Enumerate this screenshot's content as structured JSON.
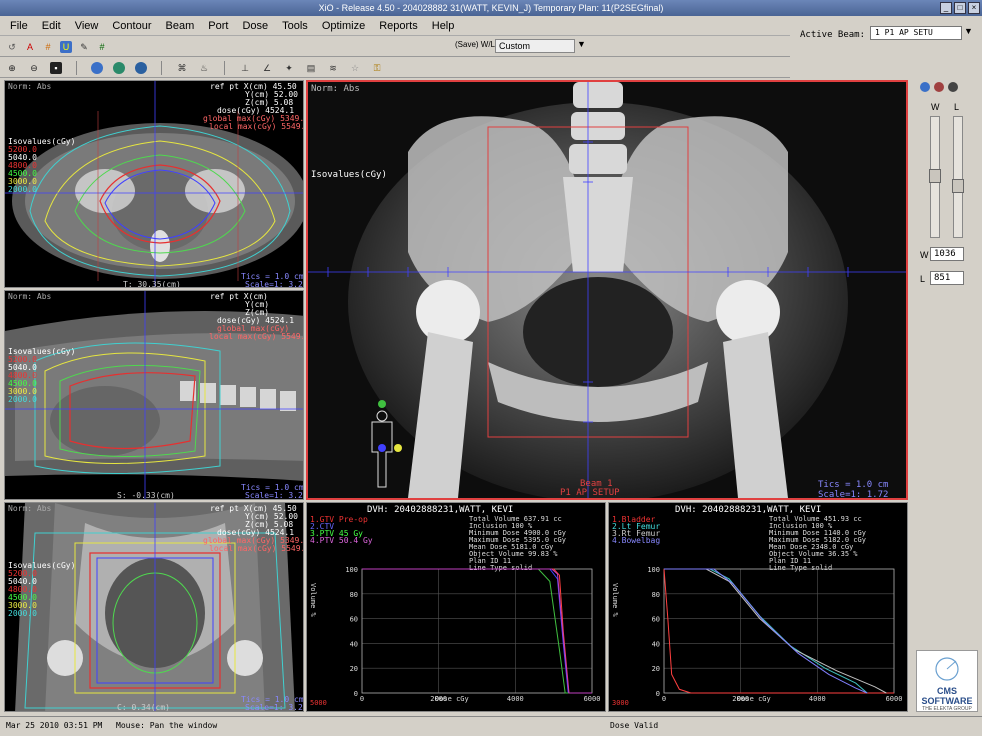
{
  "window": {
    "title": "XiO - Release 4.50 - 204028882 31(WATT, KEVIN_J) Temporary Plan: 11(P2SEGfinal)"
  },
  "menu": [
    "File",
    "Edit",
    "View",
    "Contour",
    "Beam",
    "Port",
    "Dose",
    "Tools",
    "Optimize",
    "Reports",
    "Help"
  ],
  "toolbar": {
    "save_wl_label": "(Save) W/L",
    "wl_preset": "Custom"
  },
  "active_beam": {
    "label": "Active Beam:",
    "value": "1 P1 AP SETU"
  },
  "window_level": {
    "w_label": "W",
    "l_label": "L",
    "w_value": "1036",
    "l_value": "851",
    "w_field_label": "W",
    "l_field_label": "L"
  },
  "axial_view": {
    "norm": "Norm: Abs",
    "ref_lines": [
      "ref pt  X(cm)  45.50",
      "Y(cm)  52.00",
      "Z(cm)   5.08",
      "dose(cGy)  4524.1",
      "global max(cGy)  5349.0",
      "local max(cGy)  5549.0"
    ],
    "isovalues_title": "Isovalues(cGy)",
    "isovalues": [
      "5200.0",
      "5040.0",
      "4800.0",
      "4500.0",
      "3000.0",
      "2000.0"
    ],
    "coord": "T:  30.35(cm)",
    "tics": "Tics = 1.0 cm",
    "scale": "Scale=1: 3.23"
  },
  "sagittal_view": {
    "norm": "Norm: Abs",
    "ref_lines": [
      "ref pt  X(cm)",
      "Y(cm)",
      "Z(cm)",
      "dose(cGy)  4524.1",
      "global max(cGy)",
      "local max(cGy)  5549.0"
    ],
    "isovalues_title": "Isovalues(cGy)",
    "isovalues": [
      "5200.0",
      "5040.0",
      "4800.0",
      "4500.0",
      "3000.0",
      "2000.0"
    ],
    "coord": "S:  -0.33(cm)",
    "tics": "Tics = 1.0 cm",
    "scale": "Scale=1: 3.23"
  },
  "coronal_view": {
    "norm": "Norm: Abs",
    "ref_lines": [
      "ref pt  X(cm)  45.50",
      "Y(cm)  52.00",
      "Z(cm)   5.08",
      "dose(cGy)  4524.1",
      "global max(cGy)  5349.0",
      "local max(cGy)  5549.0"
    ],
    "isovalues_title": "Isovalues(cGy)",
    "isovalues": [
      "5200.0",
      "5040.0",
      "4800.0",
      "4500.0",
      "3000.0",
      "2000.0"
    ],
    "coord": "C:  0.34(cm)",
    "tics": "Tics = 1.0 cm",
    "scale": "Scale=1: 3.23"
  },
  "drr_view": {
    "norm": "Norm: Abs",
    "isovalues_title": "Isovalues(cGy)",
    "beam": "Beam 1",
    "beam_name": "P1 AP SETUP",
    "tics": "Tics = 1.0 cm",
    "scale": "Scale=1: 1.72"
  },
  "dvh_left": {
    "header": "DVH: 20402888231,WATT, KEVI",
    "structures": [
      "1.GTV Pre-op",
      "2.CTV",
      "3.PTV 45 Gy",
      "4.PTV 50.4 Gy"
    ],
    "stats": [
      "Total Volume     637.91 cc",
      "Inclusion        100 %",
      "Minimum Dose     4900.0 cGy",
      "Maximum Dose     5395.0 cGy",
      "Mean Dose        5181.0 cGy",
      "Object Volume    99.83 %",
      "Plan ID          11",
      "Line Type        solid"
    ],
    "y_label": "Volume %",
    "x_label": "Dose cGy",
    "y_ticks": [
      "100",
      "80",
      "60",
      "40",
      "20",
      "0"
    ],
    "x_ticks": [
      "0",
      "2000",
      "4000",
      "6000"
    ],
    "x_max_marker": "5000"
  },
  "dvh_right": {
    "header": "DVH: 20402888231,WATT, KEVI",
    "structures": [
      "1.Bladder",
      "2.Lt Femur",
      "3.Rt Femur",
      "4.Bowelbag"
    ],
    "stats": [
      "Total Volume     451.93 cc",
      "Inclusion        100 %",
      "Minimum Dose     1140.0 cGy",
      "Maximum Dose     5182.0 cGy",
      "Mean Dose        2348.0 cGy",
      "Object Volume    36.35 %",
      "Plan ID          11",
      "Line Type        solid"
    ],
    "y_label": "Volume %",
    "x_label": "Dose cGy",
    "y_ticks": [
      "100",
      "80",
      "60",
      "40",
      "20",
      "0"
    ],
    "x_ticks": [
      "0",
      "2000",
      "4000",
      "6000"
    ],
    "x_max_marker": "3000"
  },
  "status": {
    "datetime": "Mar 25 2010 03:51 PM",
    "mouse": "Mouse:   Pan the window",
    "dose": "Dose Valid"
  },
  "logo": {
    "brand": "CMS SOFTWARE",
    "sub": "THE ELEKTA GROUP"
  },
  "chart_data": [
    {
      "type": "line",
      "title": "DVH: 20402888231,WATT, KEVI",
      "xlabel": "Dose cGy",
      "ylabel": "Volume %",
      "xlim": [
        0,
        6000
      ],
      "ylim": [
        0,
        100
      ],
      "series": [
        {
          "name": "1.GTV Pre-op",
          "color": "#ff4040",
          "x": [
            0,
            5000,
            5150,
            5250,
            5400,
            6000
          ],
          "y": [
            100,
            100,
            95,
            50,
            0,
            0
          ]
        },
        {
          "name": "2.CTV",
          "color": "#4040ff",
          "x": [
            0,
            4900,
            5100,
            5250,
            5380,
            6000
          ],
          "y": [
            100,
            100,
            92,
            40,
            0,
            0
          ]
        },
        {
          "name": "3.PTV 45 Gy",
          "color": "#40c040",
          "x": [
            0,
            4600,
            4900,
            5150,
            5300,
            6000
          ],
          "y": [
            100,
            100,
            90,
            35,
            0,
            0
          ]
        },
        {
          "name": "4.PTV 50.4 Gy",
          "color": "#c040c0",
          "x": [
            0,
            4950,
            5100,
            5250,
            5395,
            6000
          ],
          "y": [
            100,
            100,
            96,
            45,
            0,
            0
          ]
        }
      ]
    },
    {
      "type": "line",
      "title": "DVH: 20402888231,WATT, KEVI",
      "xlabel": "Dose cGy",
      "ylabel": "Volume %",
      "xlim": [
        0,
        6000
      ],
      "ylim": [
        0,
        100
      ],
      "series": [
        {
          "name": "1.Bladder",
          "color": "#ff4040",
          "x": [
            0,
            100,
            200,
            400,
            700,
            6000
          ],
          "y": [
            100,
            60,
            15,
            3,
            0,
            0
          ]
        },
        {
          "name": "2.Lt Femur",
          "color": "#40c0c0",
          "x": [
            0,
            1200,
            1700,
            2500,
            3300,
            4200,
            5000,
            5300
          ],
          "y": [
            100,
            100,
            92,
            62,
            38,
            20,
            8,
            0
          ]
        },
        {
          "name": "3.Rt Femur",
          "color": "#c0c0c0",
          "x": [
            0,
            1100,
            1700,
            2500,
            3400,
            4500,
            5500,
            5800
          ],
          "y": [
            100,
            100,
            90,
            60,
            35,
            18,
            5,
            0
          ]
        },
        {
          "name": "4.Bowelbag",
          "color": "#8080ff",
          "x": [
            0,
            1300,
            1800,
            2600,
            3500,
            4300,
            5000,
            5300
          ],
          "y": [
            100,
            100,
            88,
            58,
            32,
            15,
            4,
            0
          ]
        }
      ]
    }
  ]
}
